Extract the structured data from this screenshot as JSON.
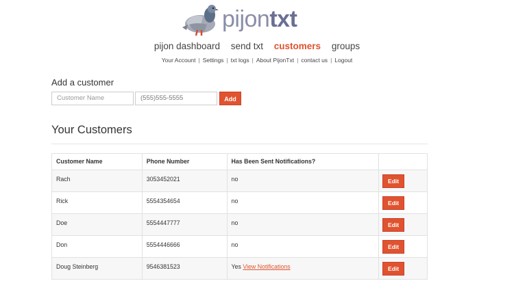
{
  "brand": {
    "name_light": "pijon",
    "name_bold": "txt",
    "colors": {
      "accent": "#e0532f",
      "logo_text": "#7a7f9f"
    }
  },
  "main_nav": [
    {
      "label": "pijon dashboard",
      "active": false
    },
    {
      "label": "send txt",
      "active": false
    },
    {
      "label": "customers",
      "active": true
    },
    {
      "label": "groups",
      "active": false
    }
  ],
  "sub_nav": [
    "Your Account",
    "Settings",
    "txt logs",
    "About PijonTxt",
    "contact us",
    "Logout"
  ],
  "add_form": {
    "title": "Add a customer",
    "name_placeholder": "Customer Name",
    "phone_placeholder": "(555)555-5555",
    "button_label": "Add"
  },
  "customers": {
    "title": "Your Customers",
    "headers": [
      "Customer Name",
      "Phone Number",
      "Has Been Sent Notifications?",
      ""
    ],
    "rows": [
      {
        "name": "Rach",
        "phone": "3053452021",
        "sent": "no",
        "link": "",
        "edit_label": "Edit"
      },
      {
        "name": "Rick",
        "phone": "5554354654",
        "sent": "no",
        "link": "",
        "edit_label": "Edit"
      },
      {
        "name": "Doe",
        "phone": "5554447777",
        "sent": "no",
        "link": "",
        "edit_label": "Edit"
      },
      {
        "name": "Don",
        "phone": "5554446666",
        "sent": "no",
        "link": "",
        "edit_label": "Edit"
      },
      {
        "name": "Doug Steinberg",
        "phone": "9546381523",
        "sent": "Yes",
        "link": "View Notifications",
        "edit_label": "Edit"
      }
    ]
  }
}
